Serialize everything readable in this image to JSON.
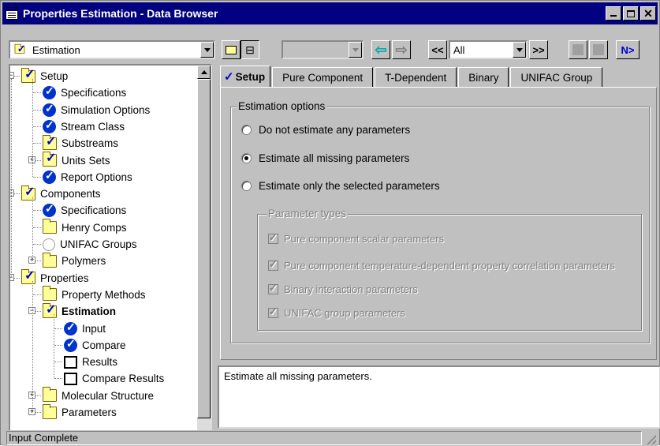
{
  "window": {
    "title": "Properties Estimation - Data Browser",
    "accent_color": "#000080"
  },
  "toolbar": {
    "location_value": "Estimation",
    "location_icon": "folder-check-icon",
    "filter_value": "All",
    "prev_nav_label": "<<",
    "next_nav_label": ">>",
    "next_label": "N>"
  },
  "tree": {
    "items": [
      {
        "label": "Setup",
        "icon": "folder-check-icon",
        "expander": "-"
      },
      {
        "label": "Specifications",
        "icon": "check-circle-icon"
      },
      {
        "label": "Simulation Options",
        "icon": "check-circle-icon"
      },
      {
        "label": "Stream Class",
        "icon": "check-circle-icon"
      },
      {
        "label": "Substreams",
        "icon": "folder-check-icon"
      },
      {
        "label": "Units Sets",
        "icon": "folder-check-icon",
        "expander": "+"
      },
      {
        "label": "Report Options",
        "icon": "check-circle-icon"
      },
      {
        "label": "Components",
        "icon": "folder-check-icon",
        "expander": "-"
      },
      {
        "label": "Specifications",
        "icon": "check-circle-icon"
      },
      {
        "label": "Henry Comps",
        "icon": "folder-icon"
      },
      {
        "label": "UNIFAC Groups",
        "icon": "empty-circle-icon"
      },
      {
        "label": "Polymers",
        "icon": "folder-icon",
        "expander": "+"
      },
      {
        "label": "Properties",
        "icon": "folder-check-icon",
        "expander": "-"
      },
      {
        "label": "Property Methods",
        "icon": "folder-icon"
      },
      {
        "label": "Estimation",
        "icon": "folder-check-icon",
        "expander": "-"
      },
      {
        "label": "Input",
        "icon": "check-circle-icon"
      },
      {
        "label": "Compare",
        "icon": "check-circle-icon"
      },
      {
        "label": "Results",
        "icon": "empty-box-icon"
      },
      {
        "label": "Compare Results",
        "icon": "empty-box-icon"
      },
      {
        "label": "Molecular Structure",
        "icon": "folder-icon",
        "expander": "+"
      },
      {
        "label": "Parameters",
        "icon": "folder-icon",
        "expander": "+"
      }
    ]
  },
  "tabs": [
    {
      "label": "Setup",
      "active": true
    },
    {
      "label": "Pure Component"
    },
    {
      "label": "T-Dependent"
    },
    {
      "label": "Binary"
    },
    {
      "label": "UNIFAC Group"
    }
  ],
  "form": {
    "group_label": "Estimation options",
    "options": [
      {
        "label": "Do not estimate any parameters",
        "selected": false
      },
      {
        "label": "Estimate all missing parameters",
        "selected": true
      },
      {
        "label": "Estimate only the selected parameters",
        "selected": false
      }
    ],
    "param_group_label": "Parameter types",
    "param_types": [
      {
        "label": "Pure component scalar parameters",
        "checked": true,
        "enabled": false
      },
      {
        "label": "Pure component temperature-dependent property correlation parameters",
        "checked": true,
        "enabled": false
      },
      {
        "label": "Binary interaction parameters",
        "checked": true,
        "enabled": false
      },
      {
        "label": "UNIFAC group parameters",
        "checked": true,
        "enabled": false
      }
    ]
  },
  "message": "Estimate all missing parameters.",
  "status": "Input Complete"
}
